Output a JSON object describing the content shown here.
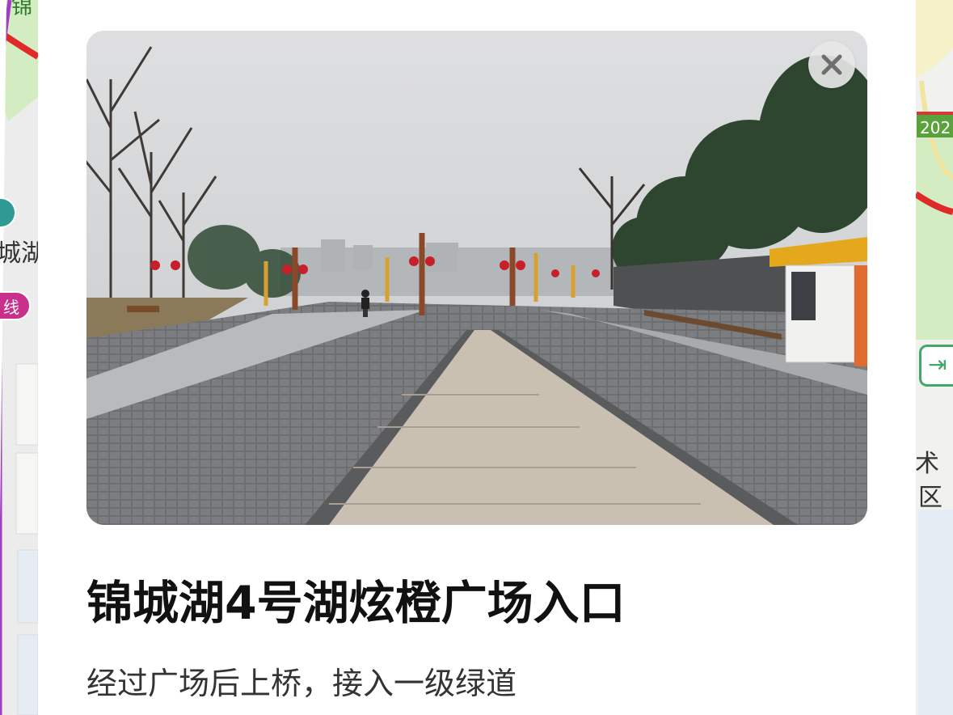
{
  "map": {
    "labels": {
      "top_left_fragment": "锦",
      "left_fragment": "城湖",
      "metro_line_fragment": "线",
      "road_number_fragment": "202",
      "right_fragment_1": "术",
      "right_fragment_2": "区"
    },
    "colors": {
      "metro_line": "#c9308c",
      "ring_road": "#e02a2a",
      "park_green": "#d4ecc2",
      "road_shield": "#5aa23c",
      "exit_icon": "#3fa86a"
    },
    "exit_icon_name": "exit-door-icon"
  },
  "poi": {
    "photo_alt": "锦城湖4号湖炫橙广场入口",
    "close_icon_name": "close-icon",
    "title": "锦城湖4号湖炫橙广场入口",
    "description": "经过广场后上桥，接入一级绿道"
  }
}
